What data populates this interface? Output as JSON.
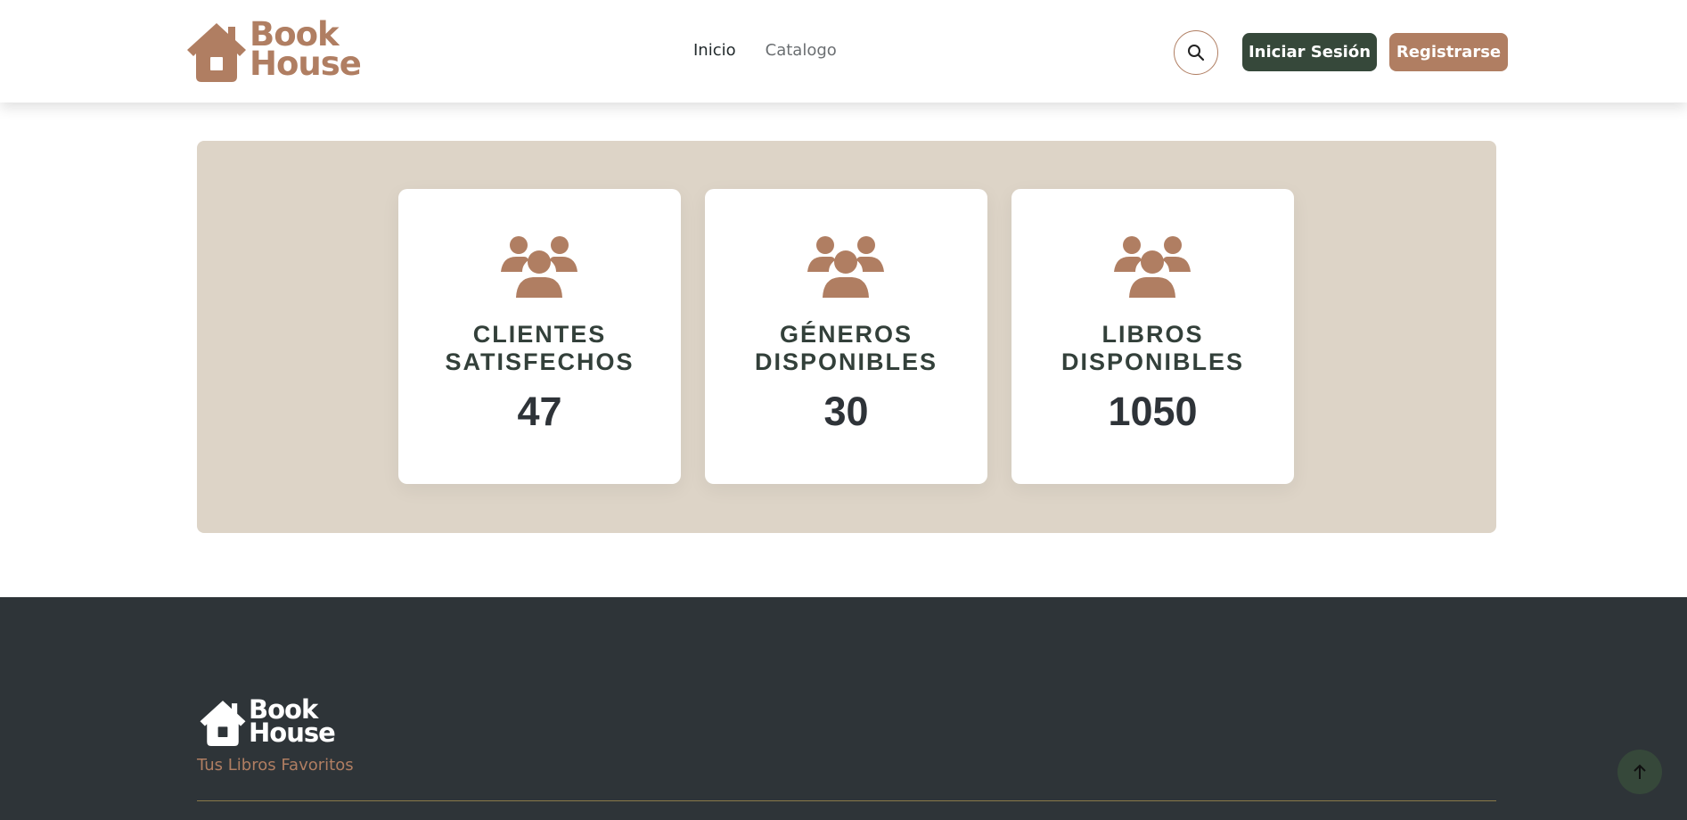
{
  "header": {
    "logo_line1": "Book",
    "logo_line2": "House",
    "nav": [
      {
        "label": "Inicio"
      },
      {
        "label": "Catalogo"
      }
    ],
    "search_icon": "search-icon",
    "login_label": "Iniciar Sesión",
    "register_label": "Registrarse"
  },
  "stats": [
    {
      "icon": "users-icon",
      "label": "CLIENTES SATISFECHOS",
      "value": "47"
    },
    {
      "icon": "users-icon",
      "label": "GÉNEROS DISPONIBLES",
      "value": "30"
    },
    {
      "icon": "users-icon",
      "label": "LIBROS DISPONIBLES",
      "value": "1050"
    }
  ],
  "footer": {
    "logo_line1": "Book",
    "logo_line2": "House",
    "tagline": "Tus Libros Favoritos"
  },
  "colors": {
    "brand_brown": "#b07e62",
    "dark_green": "#36483a",
    "panel_beige": "#ddd4c7",
    "footer_bg": "#2e3438"
  }
}
